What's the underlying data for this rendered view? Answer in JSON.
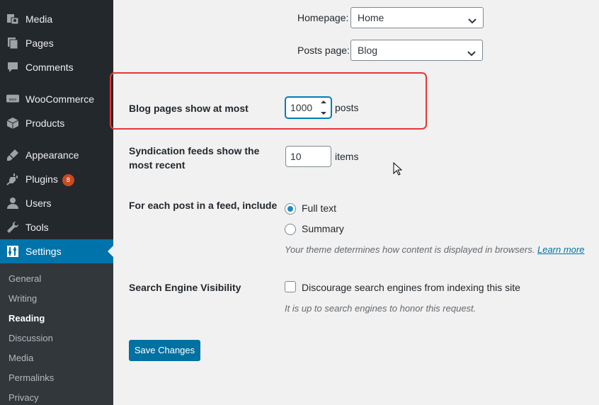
{
  "sidebar": {
    "menu": [
      {
        "name": "media",
        "label": "Media",
        "icon": "media-icon"
      },
      {
        "name": "pages",
        "label": "Pages",
        "icon": "pages-icon"
      },
      {
        "name": "comments",
        "label": "Comments",
        "icon": "comments-icon"
      },
      {
        "name": "woocommerce",
        "label": "WooCommerce",
        "icon": "woocommerce-icon"
      },
      {
        "name": "products",
        "label": "Products",
        "icon": "products-icon"
      },
      {
        "name": "appearance",
        "label": "Appearance",
        "icon": "appearance-icon"
      },
      {
        "name": "plugins",
        "label": "Plugins",
        "icon": "plugins-icon",
        "badge": "8"
      },
      {
        "name": "users",
        "label": "Users",
        "icon": "users-icon"
      },
      {
        "name": "tools",
        "label": "Tools",
        "icon": "tools-icon"
      },
      {
        "name": "settings",
        "label": "Settings",
        "icon": "settings-icon"
      }
    ],
    "submenu": [
      "General",
      "Writing",
      "Reading",
      "Discussion",
      "Media",
      "Permalinks",
      "Privacy"
    ],
    "current_submenu": "Reading"
  },
  "form": {
    "homepage_label": "Homepage:",
    "homepage_value": "Home",
    "posts_page_label": "Posts page:",
    "posts_page_value": "Blog",
    "blog_pages_label": "Blog pages show at most",
    "blog_pages_value": "1000",
    "blog_pages_unit": "posts",
    "syndication_label_line1": "Syndication feeds show the",
    "syndication_label_line2": "most recent",
    "syndication_value": "10",
    "syndication_unit": "items",
    "feed_label": "For each post in a feed, include",
    "feed_option_full": "Full text",
    "feed_option_summary": "Summary",
    "feed_selected": "Full text",
    "feed_desc": "Your theme determines how content is displayed in browsers.",
    "feed_learn_more": "Learn more",
    "visibility_label": "Search Engine Visibility",
    "visibility_checkbox_label": "Discourage search engines from indexing this site",
    "visibility_checked": false,
    "visibility_desc": "It is up to search engines to honor this request.",
    "save_button": "Save Changes"
  },
  "colors": {
    "sidebar_bg": "#23282d",
    "active_bg": "#0073aa",
    "highlight_border": "#e6353a",
    "button_bg": "#0071a1"
  }
}
